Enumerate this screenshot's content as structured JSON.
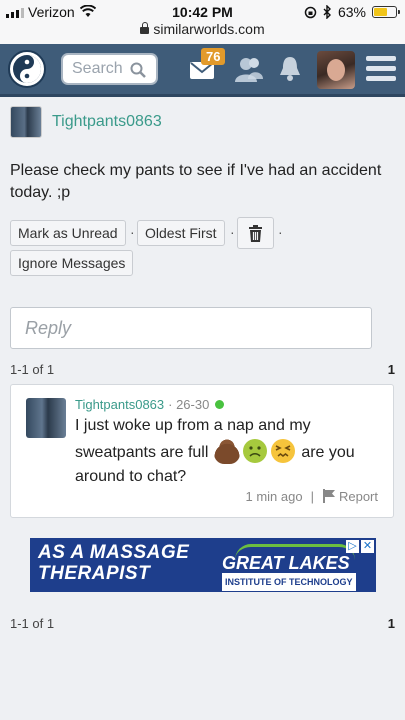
{
  "status_bar": {
    "carrier": "Verizon",
    "time": "10:42 PM",
    "battery": "63%",
    "battery_level": 0.63,
    "url": "similarworlds.com"
  },
  "header": {
    "search_placeholder": "Search",
    "mail_badge": "76",
    "colors": {
      "bar": "#3f5c79",
      "badge": "#e29a2b"
    }
  },
  "post": {
    "author": "Tightpants0863",
    "message": "Please check my pants to see if I've had an accident today. ;p",
    "actions": {
      "mark_unread": "Mark as Unread",
      "oldest_first": "Oldest First",
      "ignore": "Ignore Messages",
      "separator": "·"
    }
  },
  "reply": {
    "placeholder": "Reply"
  },
  "pager_top": {
    "range": "1-1 of 1",
    "page": "1"
  },
  "comment": {
    "author": "Tightpants0863",
    "age": "· 26-30",
    "text_before": "I just woke up from a nap and my sweatpants are full",
    "text_after": "are you around to chat?",
    "emojis": [
      "pile-of-poo-icon",
      "nauseated-face-icon",
      "persevering-face-icon"
    ],
    "time": "1 min ago",
    "divider": "|",
    "report": "Report"
  },
  "ad": {
    "line1": "AS A MASSAGE",
    "line2": "THERAPIST",
    "brand": "GREAT LAKES",
    "brand_sub": "INSTITUTE OF TECHNOLOGY",
    "adchoices": "▷",
    "close": "✕"
  },
  "pager_bottom": {
    "range": "1-1 of 1",
    "page": "1"
  }
}
